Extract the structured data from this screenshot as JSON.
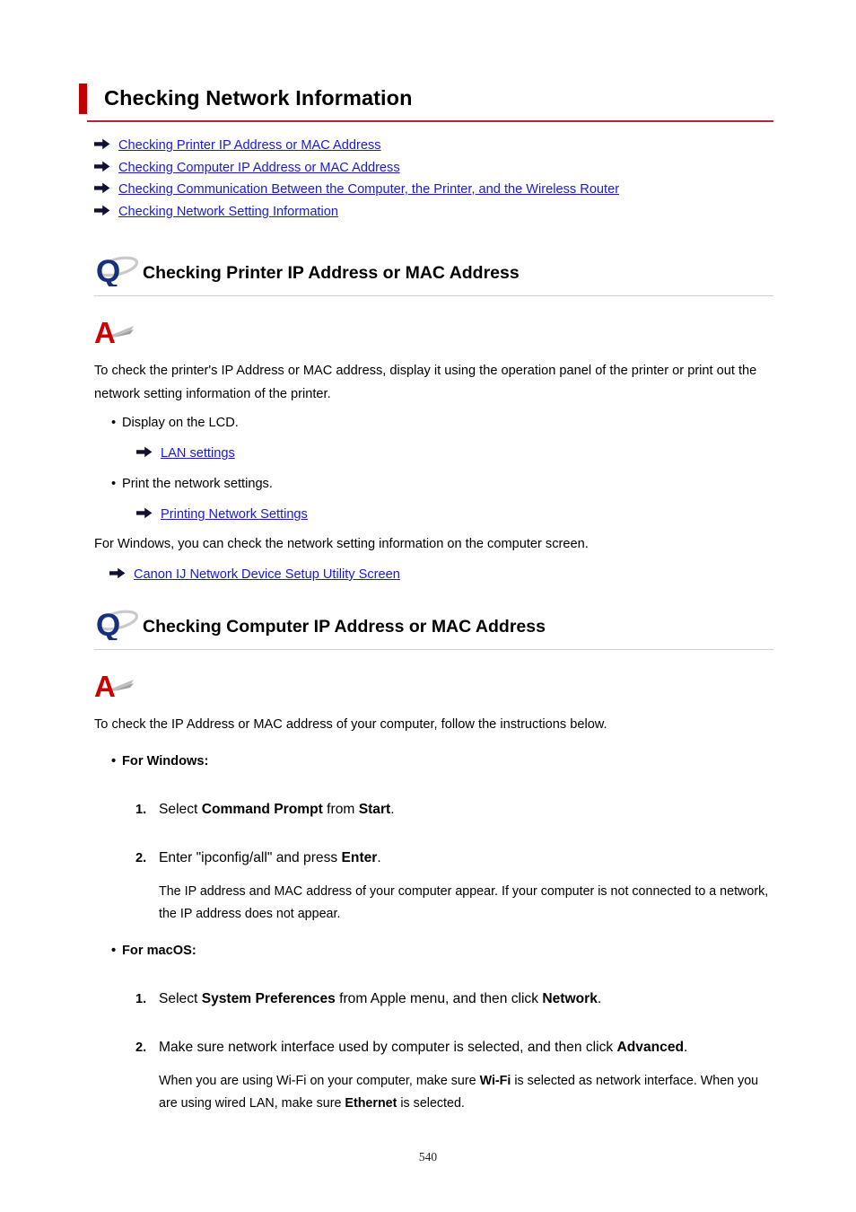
{
  "document": {
    "title": "Checking Network Information",
    "page_number": "540",
    "accent_color": "#c00000",
    "link_color": "#1a1ad6",
    "q_icon_color": "#1a3a8f",
    "a_icon_color": "#cc0000"
  },
  "toc": {
    "items": [
      {
        "icon": "arrow-right-icon",
        "label": "Checking Printer IP Address or MAC Address"
      },
      {
        "icon": "arrow-right-icon",
        "label": "Checking Computer IP Address or MAC Address"
      },
      {
        "icon": "arrow-right-icon",
        "label": "Checking Communication Between the Computer, the Printer, and the Wireless Router"
      },
      {
        "icon": "arrow-right-icon",
        "label": "Checking Network Setting Information"
      }
    ]
  },
  "section1": {
    "icon": "q-icon",
    "heading": "Checking Printer IP Address or MAC Address",
    "answer_icon": "a-icon",
    "paragraph": "To check the printer's IP Address or MAC address, display it using the operation panel of the printer or print out the network setting information of the printer.",
    "bullet1": "Display on the LCD.",
    "link1": "LAN settings",
    "bullet2": "Print the network settings.",
    "link2": "Printing Network Settings",
    "paragraph2": "For Windows, you can check the network setting information on the computer screen.",
    "link3": "Canon IJ Network Device Setup Utility Screen"
  },
  "section2": {
    "icon": "q-icon",
    "heading": "Checking Computer IP Address or MAC Address",
    "answer_icon": "a-icon",
    "paragraph": "To check the IP Address or MAC address of your computer, follow the instructions below.",
    "windows": {
      "label": "For Windows:",
      "steps": [
        {
          "number": "1.",
          "text_html": "Select <b>Command Prompt</b> from <b>Start</b>.",
          "note": ""
        },
        {
          "number": "2.",
          "text_html": "Enter \"ipconfig/all\" and press <b>Enter</b>.",
          "note": "The IP address and MAC address of your computer appear. If your computer is not connected to a network, the IP address does not appear."
        }
      ]
    },
    "macos": {
      "label": "For macOS:",
      "steps": [
        {
          "number": "1.",
          "text_html": "Select <b>System Preferences</b> from Apple menu, and then click <b>Network</b>.",
          "note": ""
        },
        {
          "number": "2.",
          "text_html": "Make sure network interface used by computer is selected, and then click <b>Advanced</b>.",
          "note_html": "When you are using Wi-Fi on your computer, make sure <b>Wi-Fi</b> is selected as network interface. When you are using wired LAN, make sure <b>Ethernet</b> is selected."
        }
      ]
    }
  }
}
